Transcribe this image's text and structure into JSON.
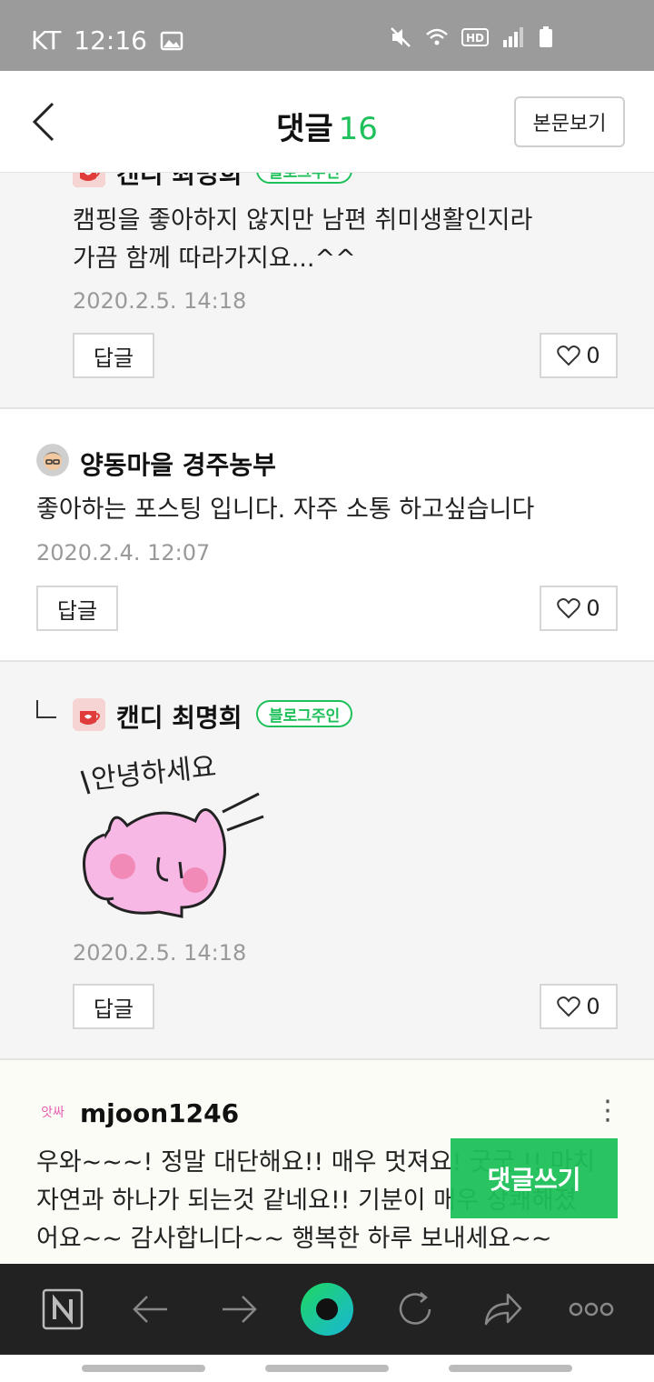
{
  "status": {
    "carrier": "KT",
    "time": "12:16"
  },
  "header": {
    "title": "댓글",
    "count": "16",
    "view_post_label": "본문보기"
  },
  "comments": [
    {
      "author": "캔디 최명희",
      "badge": "블로그주인",
      "lines": [
        "캠핑을 좋아하지 않지만 남편 취미생활인지라",
        "가끔 함께 따라가지요...^^"
      ],
      "date": "2020.2.5. 14:18",
      "reply_label": "답글",
      "likes": "0"
    },
    {
      "author": "양동마을 경주농부",
      "lines": [
        "좋아하는 포스팅 입니다. 자주 소통 하고싶습니다"
      ],
      "date": "2020.2.4. 12:07",
      "reply_label": "답글",
      "likes": "0"
    },
    {
      "author": "캔디 최명희",
      "badge": "블로그주인",
      "sticker_text": "안녕하세요",
      "date": "2020.2.5. 14:18",
      "reply_label": "답글",
      "likes": "0"
    },
    {
      "author": "mjoon1246",
      "avatar_text": "앗싸",
      "lines": [
        "우와~~~! 정말 대단해요!! 매우 멋져요! 굿굿 !! 마치",
        "자연과 하나가 되는것 같네요!! 기분이 매우 상쾌해졌",
        "어요~~ 감사합니다~~ 행복한 하루 보내세요~~"
      ],
      "more": "⋮"
    }
  ],
  "write_button_label": "댓글쓰기",
  "colors": {
    "accent": "#1ec05a",
    "status_bar": "#9b9b9b",
    "bottom_bar": "#222222"
  },
  "icons": [
    "back-icon",
    "heart-icon",
    "naver-n-icon",
    "arrow-left-icon",
    "arrow-right-icon",
    "home-circle-icon",
    "refresh-icon",
    "share-icon",
    "more-icon"
  ]
}
